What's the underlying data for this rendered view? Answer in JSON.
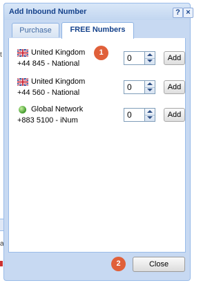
{
  "window": {
    "title": "Add Inbound Number",
    "help_label": "?",
    "close_label": "×"
  },
  "tabs": [
    {
      "label": "Purchase",
      "active": false
    },
    {
      "label": "FREE Numbers",
      "active": true
    }
  ],
  "numbers": [
    {
      "flag_icon": "uk-flag-icon",
      "country": "United Kingdom",
      "number_desc": "+44 845 - National",
      "quantity": "0",
      "add_label": "Add"
    },
    {
      "flag_icon": "uk-flag-icon",
      "country": "United Kingdom",
      "number_desc": "+44 560 - National",
      "quantity": "0",
      "add_label": "Add"
    },
    {
      "flag_icon": "globe-icon",
      "country": "Global Network",
      "number_desc": "+883 5100 - iNum",
      "quantity": "0",
      "add_label": "Add"
    }
  ],
  "callouts": {
    "first": "1",
    "second": "2"
  },
  "footer": {
    "close_label": "Close"
  },
  "background": {
    "fragment_1": "t",
    "fragment_2": "a"
  },
  "colors": {
    "accent": "#e0603a",
    "title_text": "#15428b",
    "frame": "#c7d9f2"
  }
}
